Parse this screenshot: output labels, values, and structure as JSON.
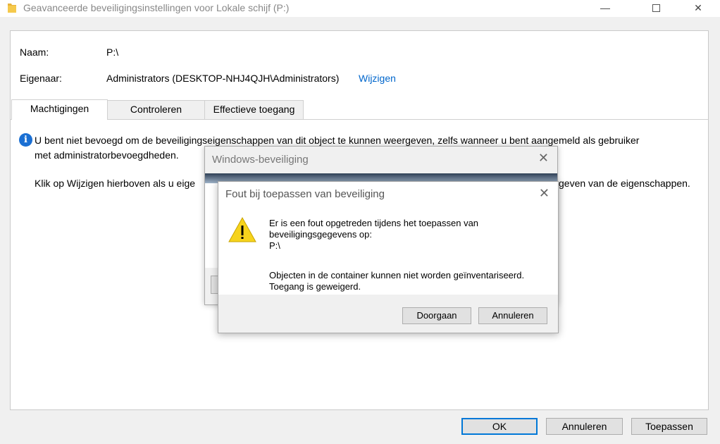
{
  "window": {
    "title": "Geavanceerde beveiligingsinstellingen voor Lokale schijf (P:)",
    "minimize_glyph": "—",
    "close_glyph": "✕"
  },
  "details": {
    "name_label": "Naam:",
    "name_value": "P:\\",
    "owner_label": "Eigenaar:",
    "owner_value": "Administrators (DESKTOP-NHJ4QJH\\Administrators)",
    "change_link": "Wijzigen"
  },
  "tabs": [
    {
      "label": "Machtigingen",
      "active": true
    },
    {
      "label": "Controleren",
      "active": false
    },
    {
      "label": "Effectieve toegang",
      "active": false
    }
  ],
  "message": {
    "line1": "U bent niet bevoegd om de beveiligingseigenschappen van dit object te kunnen weergeven, zelfs wanneer u bent aangemeld als gebruiker",
    "line2": "met administratorbevoegdheden.",
    "line3_left": "Klik op Wijzigen hierboven als u eige",
    "line3_right": "geven van de eigenschappen."
  },
  "footer": {
    "ok": "OK",
    "cancel": "Annuleren",
    "apply": "Toepassen"
  },
  "security_dialog": {
    "title": "Windows-beveiliging"
  },
  "error_dialog": {
    "title": "Fout bij toepassen van beveiliging",
    "line1": "Er is een fout opgetreden tijdens het toepassen van",
    "line2": "beveiligingsgegevens op:",
    "line3": "P:\\",
    "line4": "Objecten in de container kunnen niet worden geïnventariseerd.",
    "line5": "Toegang is geweigerd.",
    "continue_button": "Doorgaan",
    "cancel_button": "Annuleren"
  },
  "icons": {
    "folder": "folder-icon",
    "info": "info-icon",
    "warning": "warning-icon",
    "close": "close-icon"
  },
  "colors": {
    "link": "#0066cc",
    "info": "#1a6fd3",
    "warning": "#f6d31c",
    "default_button_border": "#0078d7"
  }
}
